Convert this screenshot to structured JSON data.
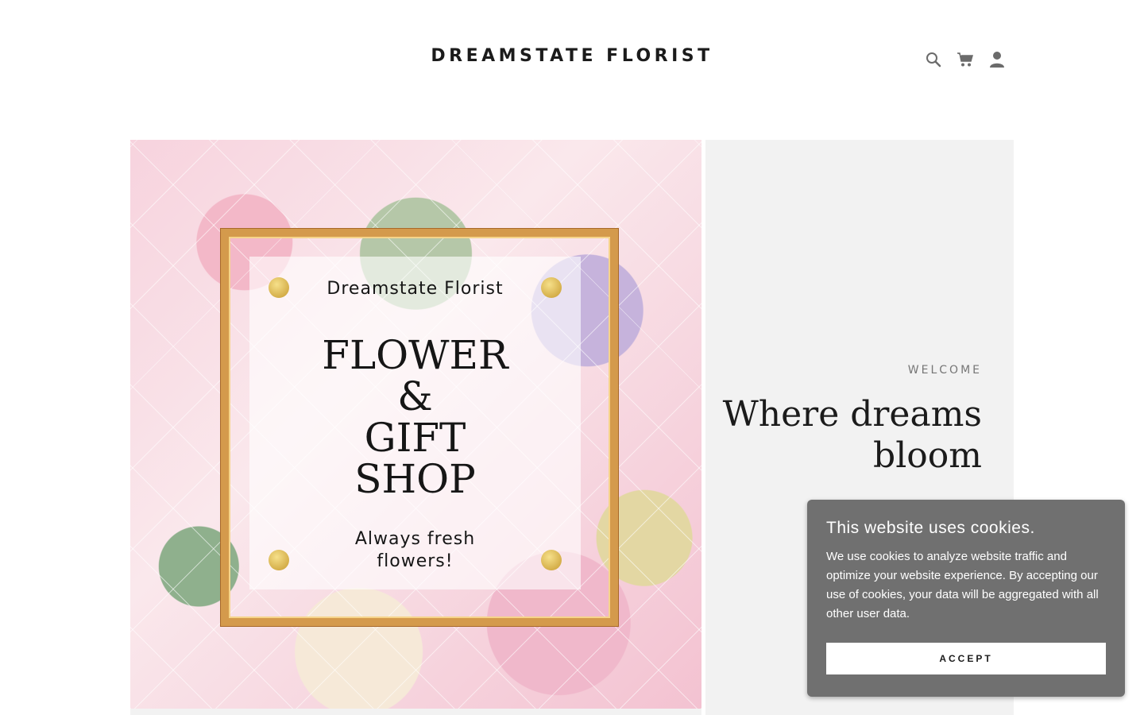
{
  "header": {
    "brand": "DREAMSTATE FLORIST",
    "icons": [
      "search-icon",
      "cart-icon",
      "account-icon"
    ]
  },
  "hero": {
    "image": {
      "brand": "Dreamstate Florist",
      "lines": [
        "FLOWER",
        "&",
        "GIFT",
        "SHOP"
      ],
      "tagline_1": "Always fresh",
      "tagline_2": "flowers!"
    },
    "eyebrow": "WELCOME",
    "headline_1": "Where dreams",
    "headline_2": "bloom"
  },
  "cookie_banner": {
    "title": "This website uses cookies.",
    "text": "We use cookies to analyze website traffic and optimize your website experience. By accepting our use of cookies, your data will be aggregated with all other user data.",
    "accept_label": "ACCEPT"
  },
  "colors": {
    "hero_bg": "#f2f2f2",
    "cookie_bg": "#707070",
    "text": "#1b1b1b",
    "frame_gold": "#d49a4c"
  }
}
